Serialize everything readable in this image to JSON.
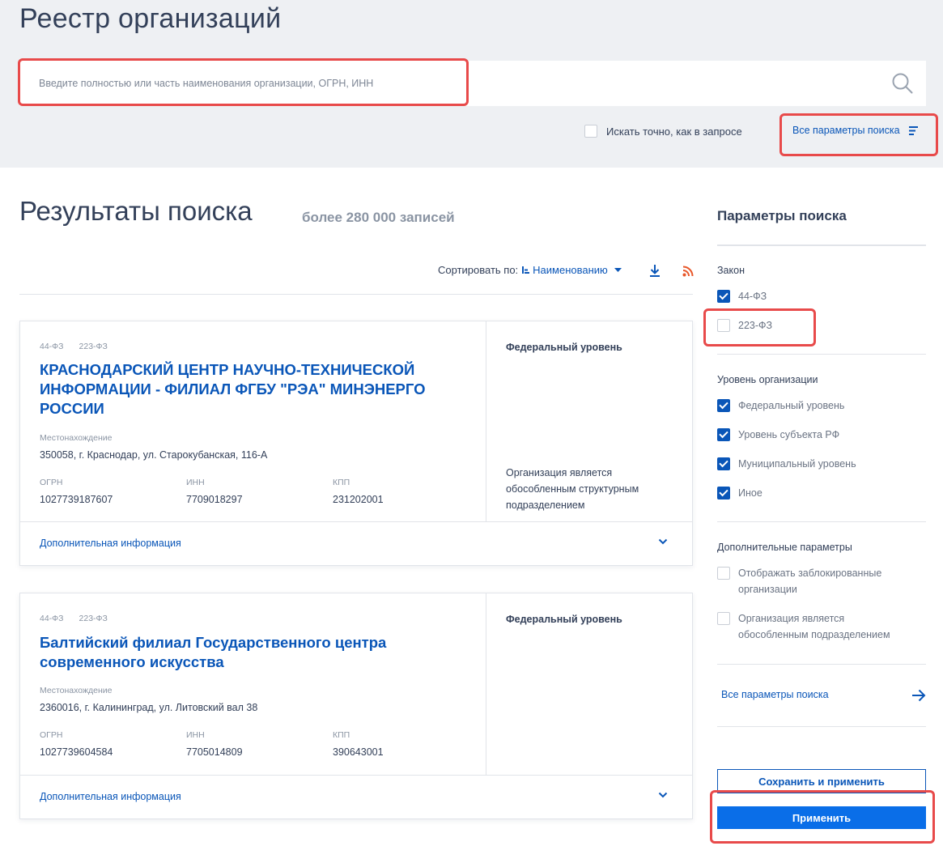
{
  "header": {
    "title": "Реестр организаций",
    "search_placeholder": "Введите полностью или часть наименования организации, ОГРН, ИНН",
    "exact_label": "Искать точно, как в запросе",
    "all_params_label": "Все параметры поиска"
  },
  "results": {
    "title": "Результаты поиска",
    "count": "более 280 000 записей",
    "sort_label": "Сортировать по:",
    "sort_value": "Наименованию"
  },
  "cards": [
    {
      "tags": [
        "44-ФЗ",
        "223-ФЗ"
      ],
      "name_lines": [
        "КРАСНОДАРСКИЙ ЦЕНТР НАУЧНО-ТЕХНИЧЕСКОЙ",
        "ИНФОРМАЦИИ - ФИЛИАЛ ФГБУ \"РЭА\" МИНЭНЕРГО",
        "РОССИИ"
      ],
      "location_label": "Местонахождение",
      "location": "350058, г. Краснодар, ул. Старокубанская, 116-А",
      "ogrn_label": "ОГРН",
      "ogrn": "1027739187607",
      "inn_label": "ИНН",
      "inn": "7709018297",
      "kpp_label": "КПП",
      "kpp": "231202001",
      "level": "Федеральный уровень",
      "note_lines": [
        "Организация является",
        "обособленным структурным",
        "подразделением"
      ],
      "more": "Дополнительная информация"
    },
    {
      "tags": [
        "44-ФЗ",
        "223-ФЗ"
      ],
      "name_lines": [
        "Балтийский филиал Государственного центра",
        "современного искусства"
      ],
      "location_label": "Местонахождение",
      "location": "2360016, г. Калининград, ул. Литовский вал 38",
      "ogrn_label": "ОГРН",
      "ogrn": "1027739604584",
      "inn_label": "ИНН",
      "inn": "7705014809",
      "kpp_label": "КПП",
      "kpp": "390643001",
      "level": "Федеральный уровень",
      "more": "Дополнительная информация"
    }
  ],
  "panel": {
    "title": "Параметры поиска",
    "law_title": "Закон",
    "law_options": [
      {
        "label": "44-ФЗ",
        "checked": true
      },
      {
        "label": "223-ФЗ",
        "checked": false
      }
    ],
    "level_title": "Уровень организации",
    "level_options": [
      {
        "label": "Федеральный уровень",
        "checked": true
      },
      {
        "label": "Уровень субъекта РФ",
        "checked": true
      },
      {
        "label": "Муниципальный уровень",
        "checked": true
      },
      {
        "label": "Иное",
        "checked": true
      }
    ],
    "extra_title": "Дополнительные параметры",
    "extra_options": [
      {
        "lines": [
          "Отображать заблокированные",
          "организации"
        ],
        "checked": false
      },
      {
        "lines": [
          "Организация является",
          "обособленным подразделением"
        ],
        "checked": false
      }
    ],
    "all_params_label": "Все параметры поиска",
    "save_apply": "Сохранить и применить",
    "apply": "Применить"
  },
  "colors": {
    "accent": "#0a56b8",
    "primary_button": "#0a6ee8",
    "highlight": "#e84a4a",
    "rss": "#e8572a",
    "header_bg": "#eef0f3"
  }
}
